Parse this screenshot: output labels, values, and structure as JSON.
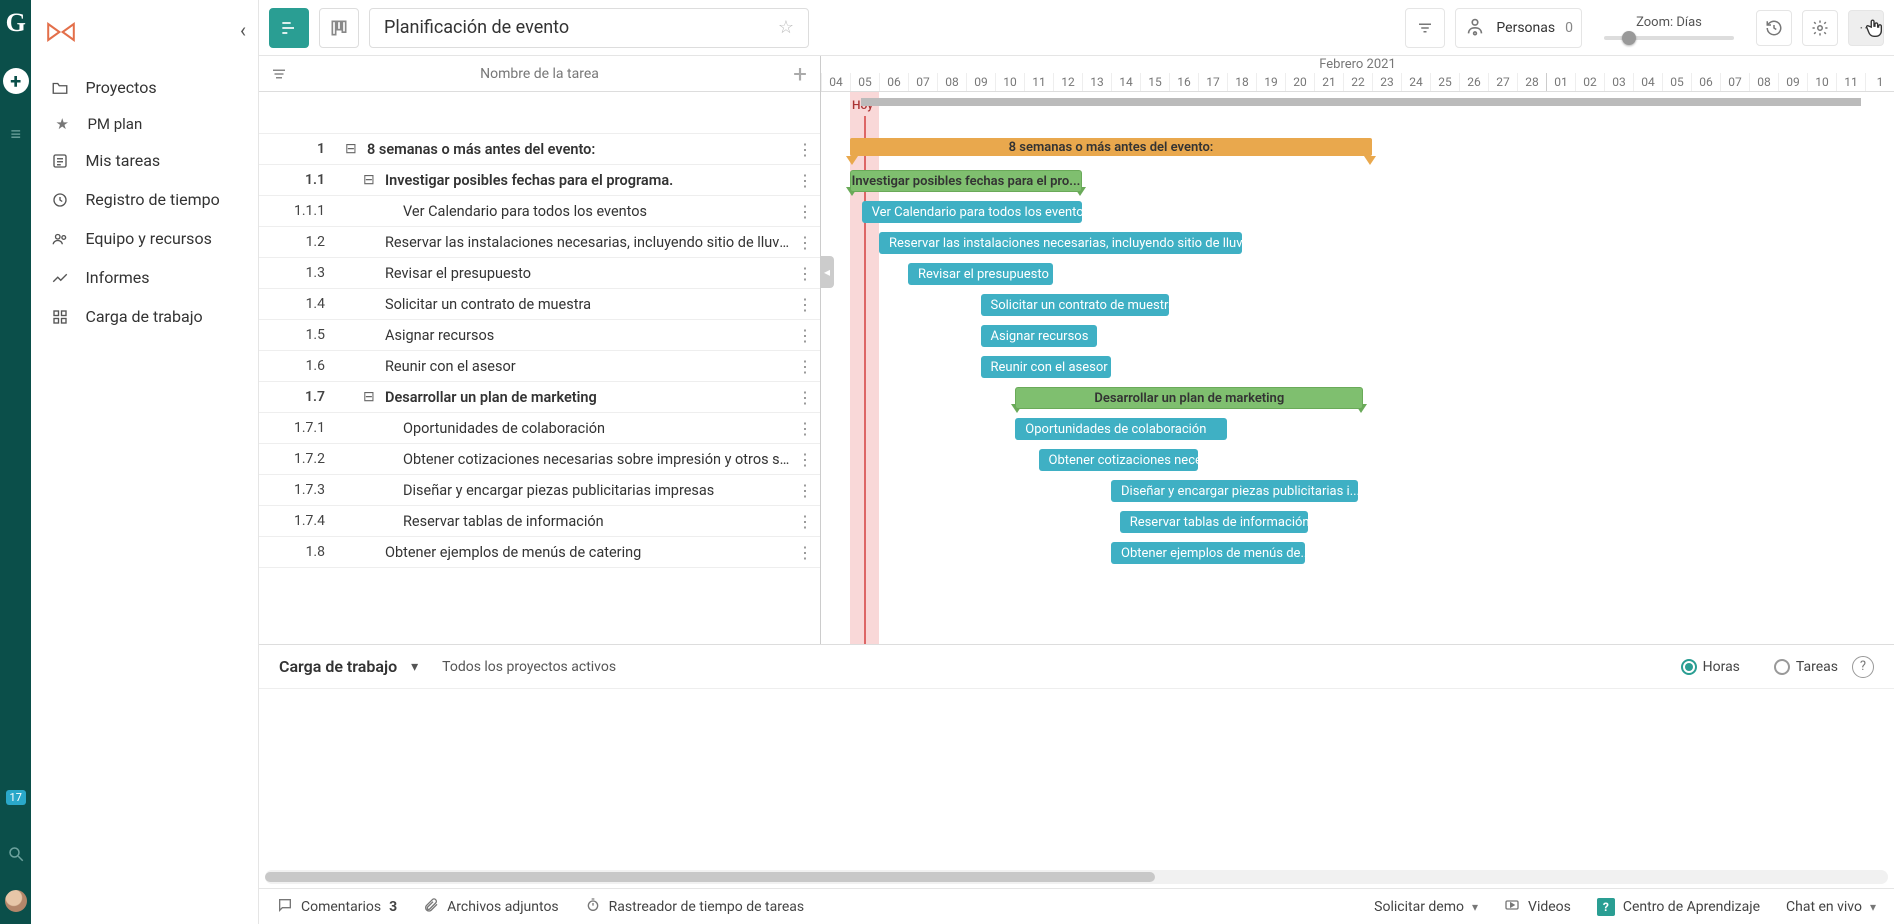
{
  "rail": {
    "badge": "17"
  },
  "sidebar": {
    "items": [
      {
        "label": "Proyectos"
      },
      {
        "label": "PM plan"
      },
      {
        "label": "Mis tareas"
      },
      {
        "label": "Registro de tiempo"
      },
      {
        "label": "Equipo y recursos"
      },
      {
        "label": "Informes"
      },
      {
        "label": "Carga de trabajo"
      }
    ]
  },
  "header": {
    "title": "Planificación de evento",
    "people_label": "Personas",
    "people_count": "0",
    "zoom_label": "Zoom: Días"
  },
  "grid": {
    "column_label": "Nombre de la tarea",
    "tasks": [
      {
        "num": "1",
        "name": "8 semanas o más antes del evento:",
        "bold": true,
        "indent": 1,
        "exp": true
      },
      {
        "num": "1.1",
        "name": "Investigar posibles fechas para el programa.",
        "bold": true,
        "indent": 2,
        "exp": true
      },
      {
        "num": "1.1.1",
        "name": "Ver Calendario para todos los eventos",
        "bold": false,
        "indent": 3
      },
      {
        "num": "1.2",
        "name": "Reservar las instalaciones necesarias, incluyendo sitio de lluvia",
        "bold": false,
        "indent": 2
      },
      {
        "num": "1.3",
        "name": "Revisar el presupuesto",
        "bold": false,
        "indent": 2
      },
      {
        "num": "1.4",
        "name": "Solicitar un contrato de muestra",
        "bold": false,
        "indent": 2
      },
      {
        "num": "1.5",
        "name": "Asignar recursos",
        "bold": false,
        "indent": 2
      },
      {
        "num": "1.6",
        "name": "Reunir con el asesor",
        "bold": false,
        "indent": 2
      },
      {
        "num": "1.7",
        "name": "Desarrollar un plan de marketing",
        "bold": true,
        "indent": 2,
        "exp": true
      },
      {
        "num": "1.7.1",
        "name": "Oportunidades de colaboración",
        "bold": false,
        "indent": 3
      },
      {
        "num": "1.7.2",
        "name": "Obtener cotizaciones necesarias sobre impresión y otros ser...",
        "bold": false,
        "indent": 3
      },
      {
        "num": "1.7.3",
        "name": "Diseñar y encargar piezas publicitarias impresas",
        "bold": false,
        "indent": 3
      },
      {
        "num": "1.7.4",
        "name": "Reservar tablas de información",
        "bold": false,
        "indent": 3
      },
      {
        "num": "1.8",
        "name": "Obtener ejemplos de menús de catering",
        "bold": false,
        "indent": 2
      }
    ]
  },
  "gantt": {
    "month": "Febrero 2021",
    "today_label": "Hoy",
    "days": [
      "04",
      "05",
      "06",
      "07",
      "08",
      "09",
      "10",
      "11",
      "12",
      "13",
      "14",
      "15",
      "16",
      "17",
      "18",
      "19",
      "20",
      "21",
      "22",
      "23",
      "24",
      "25",
      "26",
      "27",
      "28",
      "01",
      "02",
      "03",
      "04",
      "05",
      "06",
      "07",
      "08",
      "09",
      "10",
      "11",
      "1"
    ],
    "separator_at": 25,
    "bars": [
      {
        "row": 0,
        "type": "summary",
        "start": 1,
        "span": 18,
        "label": "8 semanas o más antes del evento:"
      },
      {
        "row": 1,
        "type": "group",
        "start": 1,
        "span": 8,
        "label": "Investigar posibles fechas para el pro..."
      },
      {
        "row": 2,
        "type": "task",
        "start": 1.4,
        "span": 7.6,
        "label": "Ver Calendario para todos los eventos"
      },
      {
        "row": 3,
        "type": "task",
        "start": 2,
        "span": 12.5,
        "label": "Reservar las instalaciones necesarias, incluyendo sitio de lluvia"
      },
      {
        "row": 4,
        "type": "task",
        "start": 3,
        "span": 5,
        "label": "Revisar el presupuesto"
      },
      {
        "row": 5,
        "type": "task",
        "start": 5.5,
        "span": 6.5,
        "label": "Solicitar un contrato de muestra"
      },
      {
        "row": 6,
        "type": "task",
        "start": 5.5,
        "span": 4,
        "label": "Asignar recursos"
      },
      {
        "row": 7,
        "type": "task",
        "start": 5.5,
        "span": 4.5,
        "label": "Reunir con el asesor"
      },
      {
        "row": 8,
        "type": "group",
        "start": 6.7,
        "span": 12,
        "label": "Desarrollar un plan de marketing"
      },
      {
        "row": 9,
        "type": "task",
        "start": 6.7,
        "span": 7.3,
        "label": "Oportunidades de colaboración"
      },
      {
        "row": 10,
        "type": "task",
        "start": 7.5,
        "span": 5.5,
        "label": "Obtener cotizaciones nece..."
      },
      {
        "row": 11,
        "type": "task",
        "start": 10,
        "span": 8.5,
        "label": "Diseñar y encargar piezas publicitarias i..."
      },
      {
        "row": 12,
        "type": "task",
        "start": 10.3,
        "span": 6.5,
        "label": "Reservar tablas de información"
      },
      {
        "row": 13,
        "type": "task",
        "start": 10,
        "span": 6.7,
        "label": "Obtener ejemplos de menús de..."
      }
    ]
  },
  "workload": {
    "title": "Carga de trabajo",
    "filter": "Todos los proyectos activos",
    "radio_hours": "Horas",
    "radio_tasks": "Tareas"
  },
  "footer": {
    "comments": "Comentarios",
    "comments_count": "3",
    "attachments": "Archivos adjuntos",
    "tracker": "Rastreador de tiempo de tareas",
    "demo": "Solicitar demo",
    "videos": "Videos",
    "learning": "Centro de Aprendizaje",
    "chat": "Chat en vivo"
  }
}
